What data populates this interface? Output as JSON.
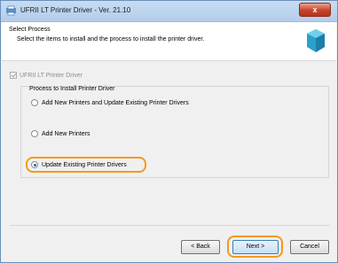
{
  "window": {
    "title": "UFRII LT Printer Driver - Ver. 21.10",
    "close_label": "x"
  },
  "header": {
    "title": "Select Process",
    "description": "Select the items to install and the process to install the printer driver."
  },
  "component": {
    "label": "UFRII LT Printer Driver",
    "checked": true,
    "enabled": false
  },
  "process_group": {
    "title": "Process to Install Printer Driver",
    "options": [
      {
        "label": "Add New Printers and Update Existing Printer Drivers",
        "selected": false
      },
      {
        "label": "Add New Printers",
        "selected": false
      },
      {
        "label": "Update Existing Printer Drivers",
        "selected": true
      }
    ]
  },
  "buttons": {
    "back": "< Back",
    "next": "Next >",
    "cancel": "Cancel"
  },
  "colors": {
    "highlight": "#f39a1d",
    "selected_radio": "#2a5fb0"
  }
}
